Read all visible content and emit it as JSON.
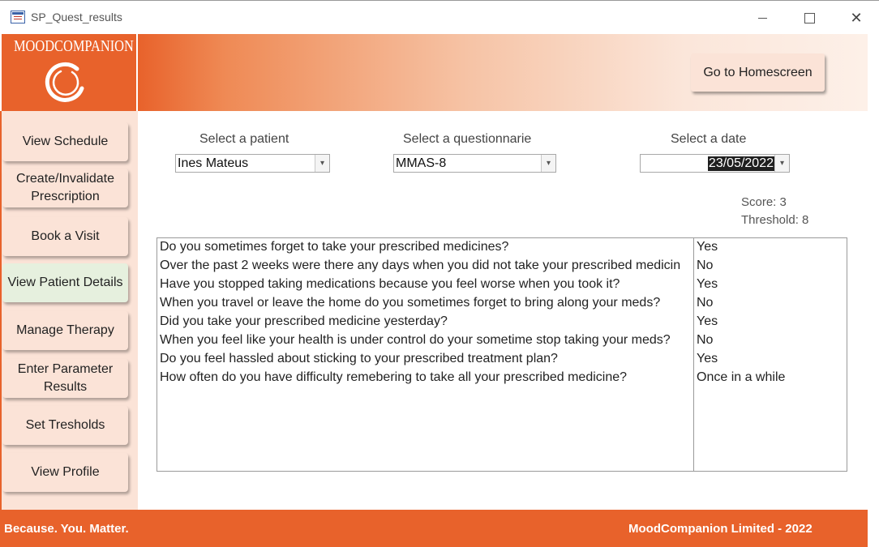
{
  "window": {
    "title": "SP_Quest_results",
    "minimize_icon": "minimize-icon",
    "maximize_icon": "maximize-icon",
    "close_glyph": "✕"
  },
  "brand": {
    "logo_text": "MOODCOMPANION",
    "primary_color": "#e8622b",
    "light_color": "#fbe3d7",
    "active_color": "#e6f0de"
  },
  "header": {
    "home_button": "Go to Homescreen"
  },
  "sidebar": {
    "items": [
      {
        "label": "View Schedule",
        "active": false
      },
      {
        "label": "Create/Invalidate Prescription",
        "active": false
      },
      {
        "label": "Book a Visit",
        "active": false
      },
      {
        "label": "View Patient Details",
        "active": true
      },
      {
        "label": "Manage Therapy",
        "active": false
      },
      {
        "label": "Enter Parameter Results",
        "active": false
      },
      {
        "label": "Set Tresholds",
        "active": false
      },
      {
        "label": "View Profile",
        "active": false
      }
    ]
  },
  "filters": {
    "patient_label": "Select a patient",
    "patient_value": "Ines Mateus",
    "questionnaire_label": "Select a questionnarie",
    "questionnaire_value": "MMAS-8",
    "date_label": "Select a date",
    "date_value": "23/05/2022",
    "dropdown_glyph": "▾"
  },
  "score": {
    "score_text": "Score: 3",
    "threshold_text": "Threshold: 8"
  },
  "questions": [
    {
      "question": "Do you sometimes forget to take your prescribed medicines?",
      "answer": "Yes"
    },
    {
      "question": "Over the past 2 weeks were there any days when you did not take your prescribed medicin",
      "answer": "No"
    },
    {
      "question": "Have you stopped taking medications because you feel worse when you took it?",
      "answer": "Yes"
    },
    {
      "question": "When you travel or leave the home do you sometimes forget to bring along your meds?",
      "answer": "No"
    },
    {
      "question": "Did you take your prescribed medicine yesterday?",
      "answer": "Yes"
    },
    {
      "question": "When you feel like your health is under control do your sometime stop taking your meds?",
      "answer": "No"
    },
    {
      "question": "Do you feel hassled about sticking to your prescribed treatment plan?",
      "answer": "Yes"
    },
    {
      "question": "How often do you have difficulty remebering to take all your prescribed medicine?",
      "answer": "Once in a while"
    }
  ],
  "footer": {
    "tagline": "Because. You. Matter.",
    "copyright": "MoodCompanion Limited - 2022"
  }
}
